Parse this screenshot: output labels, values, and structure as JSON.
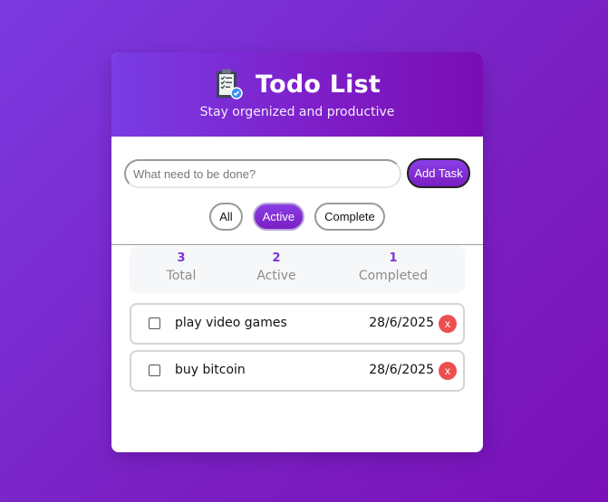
{
  "header": {
    "icon": "clipboard-check-icon",
    "title": "Todo List",
    "subtitle": "Stay orgenized and productive"
  },
  "input": {
    "value": "",
    "placeholder": "What need to be done?",
    "add_label": "Add Task"
  },
  "filters": {
    "all": "All",
    "active": "Active",
    "complete": "Complete",
    "selected": "Active"
  },
  "stats": {
    "total_count": "3",
    "total_label": "Total",
    "active_count": "2",
    "active_label": "Active",
    "completed_count": "1",
    "completed_label": "Completed"
  },
  "tasks": [
    {
      "text": "play video games",
      "date": "28/6/2025",
      "done": false,
      "delete_label": "x"
    },
    {
      "text": "buy bitcoin",
      "date": "28/6/2025",
      "done": false,
      "delete_label": "x"
    }
  ],
  "colors": {
    "accent": "#7a34d6",
    "delete": "#ec4f4f"
  }
}
